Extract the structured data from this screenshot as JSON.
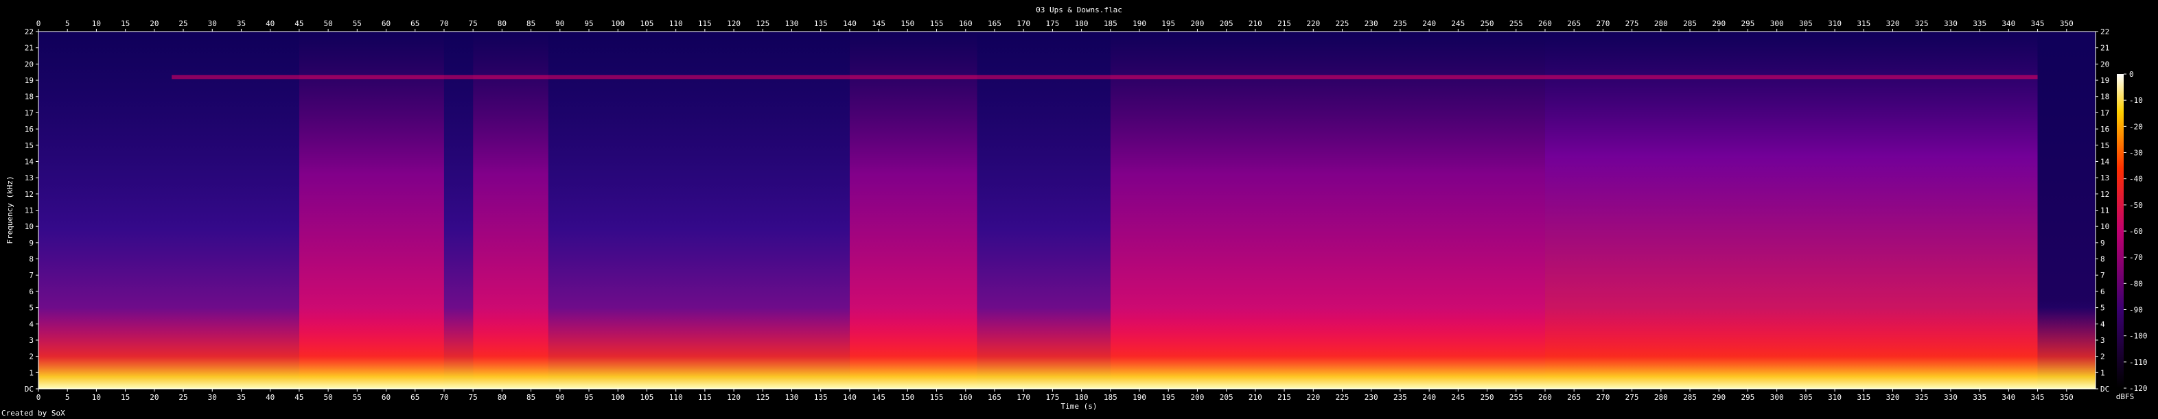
{
  "chart_data": {
    "type": "heatmap",
    "title": "03 Ups & Downs.flac",
    "xlabel": "Time (s)",
    "ylabel": "Frequency (kHz)",
    "xlim": [
      0,
      355
    ],
    "ylim": [
      0,
      22
    ],
    "x_ticks": [
      0,
      5,
      10,
      15,
      20,
      25,
      30,
      35,
      40,
      45,
      50,
      55,
      60,
      65,
      70,
      75,
      80,
      85,
      90,
      95,
      100,
      105,
      110,
      115,
      120,
      125,
      130,
      135,
      140,
      145,
      150,
      155,
      160,
      165,
      170,
      175,
      180,
      185,
      190,
      195,
      200,
      205,
      210,
      215,
      220,
      225,
      230,
      235,
      240,
      245,
      250,
      255,
      260,
      265,
      270,
      275,
      280,
      285,
      290,
      295,
      300,
      305,
      310,
      315,
      320,
      325,
      330,
      335,
      340,
      345,
      350
    ],
    "y_ticks": [
      "DC",
      "1",
      "2",
      "3",
      "4",
      "5",
      "6",
      "7",
      "8",
      "9",
      "10",
      "11",
      "12",
      "13",
      "14",
      "15",
      "16",
      "17",
      "18",
      "19",
      "20",
      "21",
      "22"
    ],
    "colorbar": {
      "unit": "dBFS",
      "ticks": [
        "0",
        "-10",
        "-20",
        "-30",
        "-40",
        "-50",
        "-60",
        "-70",
        "-80",
        "-90",
        "-100",
        "-110",
        "-120"
      ],
      "range": [
        -120,
        0
      ]
    },
    "sections": [
      {
        "start": 0,
        "end": 45,
        "level": "moderate"
      },
      {
        "start": 45,
        "end": 70,
        "level": "loud"
      },
      {
        "start": 70,
        "end": 75,
        "level": "moderate"
      },
      {
        "start": 75,
        "end": 88,
        "level": "loud"
      },
      {
        "start": 88,
        "end": 140,
        "level": "moderate"
      },
      {
        "start": 140,
        "end": 162,
        "level": "loud"
      },
      {
        "start": 162,
        "end": 185,
        "level": "moderate"
      },
      {
        "start": 185,
        "end": 260,
        "level": "loud"
      },
      {
        "start": 260,
        "end": 345,
        "level": "loudest"
      },
      {
        "start": 345,
        "end": 355,
        "level": "fade"
      }
    ],
    "tone_line_khz": 19.2,
    "colors": {
      "low": "#000050",
      "mid": "#ee0060",
      "high": "#ffff40",
      "max": "#ffffff"
    }
  },
  "footer": {
    "credit": "Created by SoX"
  }
}
